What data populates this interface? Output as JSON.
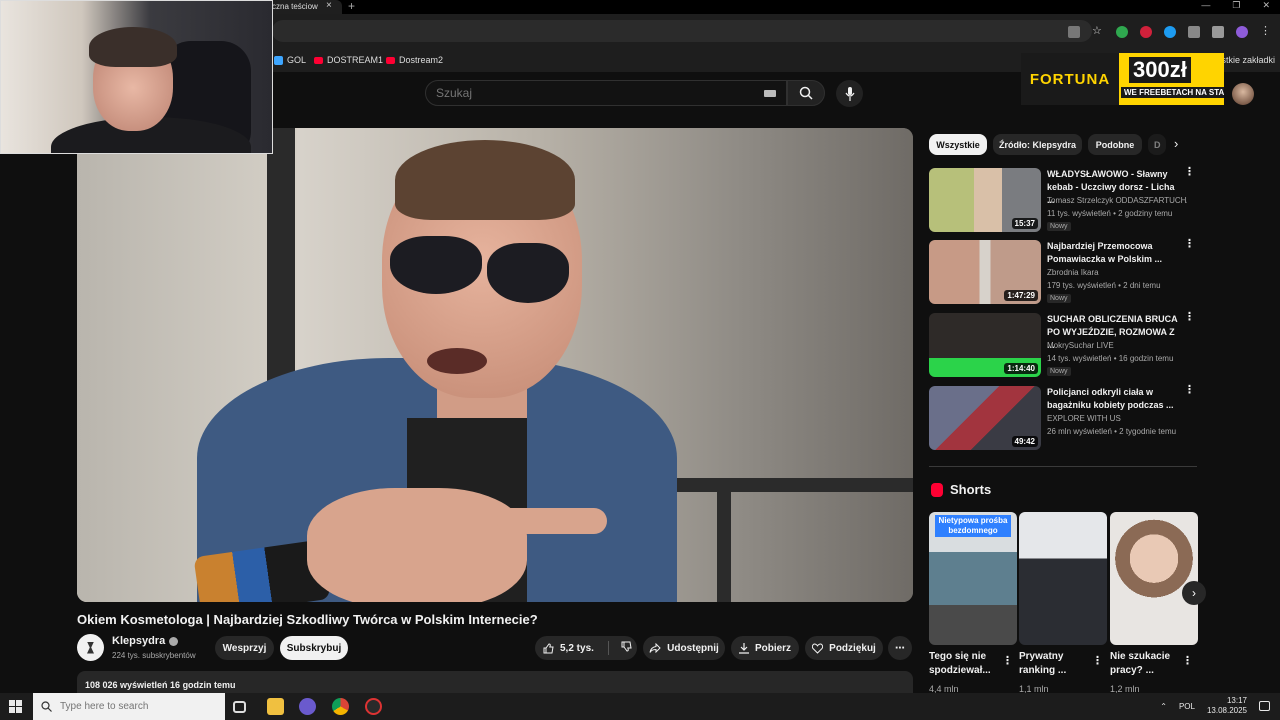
{
  "browser": {
    "tab_title": "czna teściow",
    "tab_close": "×",
    "new_tab": "+",
    "bookmarks": [
      {
        "label": "GOL"
      },
      {
        "label": "DOSTREAM1"
      },
      {
        "label": "Dostream2"
      }
    ],
    "all_bookmarks": "ystkie zakładki"
  },
  "header": {
    "search_placeholder": "Szukaj"
  },
  "ad": {
    "brand": "FORTUNA",
    "amount": "300zł",
    "subtitle": "WE FREEBETACH NA START"
  },
  "video": {
    "title": "Okiem Kosmetologa | Najbardziej Szkodliwy Twórca w Polskim Internecie?",
    "channel": "Klepsydra",
    "subscribers": "224 tys. subskrybentów",
    "support_label": "Wesprzyj",
    "subscribe_label": "Subskrybuj",
    "likes": "5,2 tys.",
    "share_label": "Udostępnij",
    "download_label": "Pobierz",
    "thanks_label": "Podziękuj",
    "views_line": "108 026 wyświetleń  16 godzin temu"
  },
  "chips": [
    {
      "label": "Wszystkie",
      "active": true
    },
    {
      "label": "Źródło: Klepsydra",
      "active": false
    },
    {
      "label": "Podobne",
      "active": false
    },
    {
      "label": "D",
      "active": false
    }
  ],
  "recommended": [
    {
      "title": "WŁADYSŁAWOWO - Sławny kebab - Uczciwy dorsz - Licha ...",
      "channel": "Tomasz Strzelczyk ODDASZFARTUCHA",
      "meta": "11 tys. wyświetleń • 2 godziny temu",
      "badge": "Nowy",
      "duration": "15:37"
    },
    {
      "title": "Najbardziej Przemocowa Pomawiaczka w Polskim ...",
      "channel": "Zbrodnia Ikara",
      "meta": "179 tys. wyświetleń • 2 dni temu",
      "badge": "Nowy",
      "duration": "1:47:29"
    },
    {
      "title": "SUCHAR OBLICZENIA BRUCA PO WYJEŹDZIE, ROZMOWA Z ...",
      "channel": "MokrySuchar LIVE",
      "meta": "14 tys. wyświetleń • 16 godzin temu",
      "badge": "Nowy",
      "duration": "1:14:40"
    },
    {
      "title": "Policjanci odkryli ciała w bagażniku kobiety podczas ...",
      "channel": "EXPLORE WITH US",
      "meta": "26 mln wyświetleń • 2 tygodnie temu",
      "badge": "",
      "duration": "49:42"
    }
  ],
  "shorts": {
    "heading": "Shorts",
    "items": [
      {
        "caption": "Tego się nie spodziewał...",
        "views": "4,4 mln",
        "overlay": "Nietypowa prośba bezdomnego"
      },
      {
        "caption": "Prywatny ranking ...",
        "views": "1,1 mln",
        "overlay": ""
      },
      {
        "caption": "Nie szukacie pracy? ...",
        "views": "1,2 mln",
        "overlay": ""
      }
    ]
  },
  "taskbar": {
    "search_placeholder": "Type here to search",
    "lang": "POL",
    "time": "13:17",
    "date": "13.08.2025"
  },
  "colors": {
    "background": "#0f0f0f",
    "surface": "#272727",
    "text": "#f1f1f1",
    "secondary_text": "#aaaaaa",
    "accent_red": "#ff0033",
    "ad_yellow": "#ffd400"
  }
}
